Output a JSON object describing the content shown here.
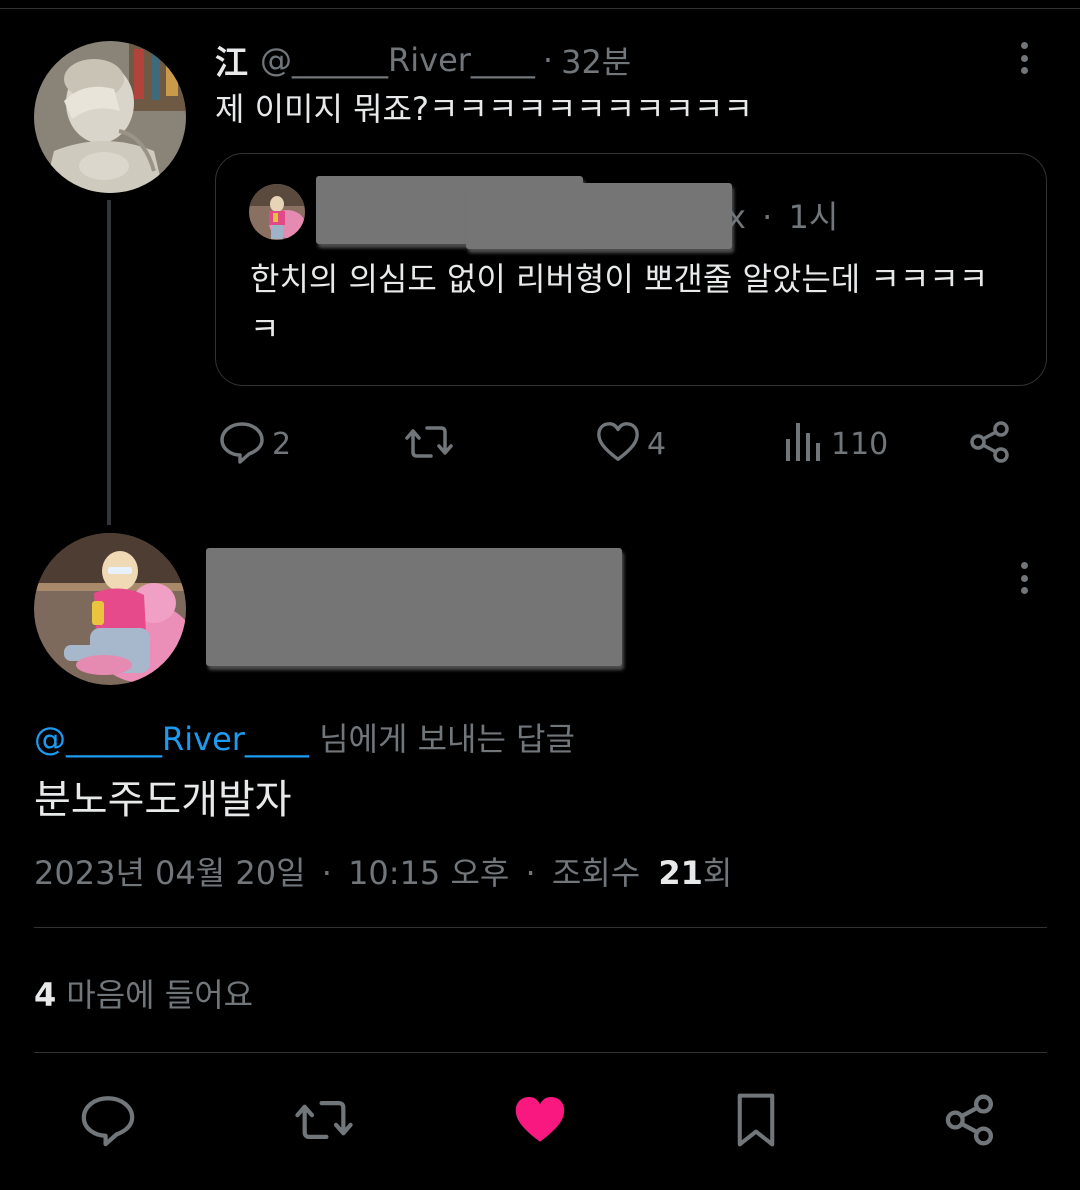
{
  "parent_tweet": {
    "display_name": "江",
    "handle": "@______River____",
    "separator": "·",
    "time_ago": "32분",
    "text": "제 이미지 뭐죠?ㅋㅋㅋㅋㅋㅋㅋㅋㅋㅋㅋ",
    "quote": {
      "handle_tail": "x",
      "separator": "·",
      "time_ago": "1시",
      "text": "한치의 의심도 없이 리버형이 뽀갠줄 알았는데 ㅋㅋㅋㅋㅋ"
    },
    "actions": {
      "replies": "2",
      "retweets": "",
      "likes": "4",
      "views": "110"
    }
  },
  "main_tweet": {
    "replying_to_handle": "@______River____",
    "replying_to_suffix": " 님에게 보내는 답글",
    "text": "분노주도개발자",
    "date": "2023년 04월 20일",
    "separator": "·",
    "time": "10:15 오후",
    "views_label": "조회수",
    "views_count": "21",
    "views_unit": "회",
    "likes_count": "4",
    "likes_label": "마음에 들어요"
  },
  "colors": {
    "background": "#000000",
    "text_primary": "#e7e9ea",
    "text_secondary": "#71767b",
    "link_blue": "#1d9bf0",
    "like_pink": "#f91880",
    "divider": "#2f3336"
  },
  "icons": [
    "reply-icon",
    "retweet-icon",
    "like-icon",
    "views-icon",
    "share-icon",
    "bookmark-icon",
    "more-icon"
  ]
}
